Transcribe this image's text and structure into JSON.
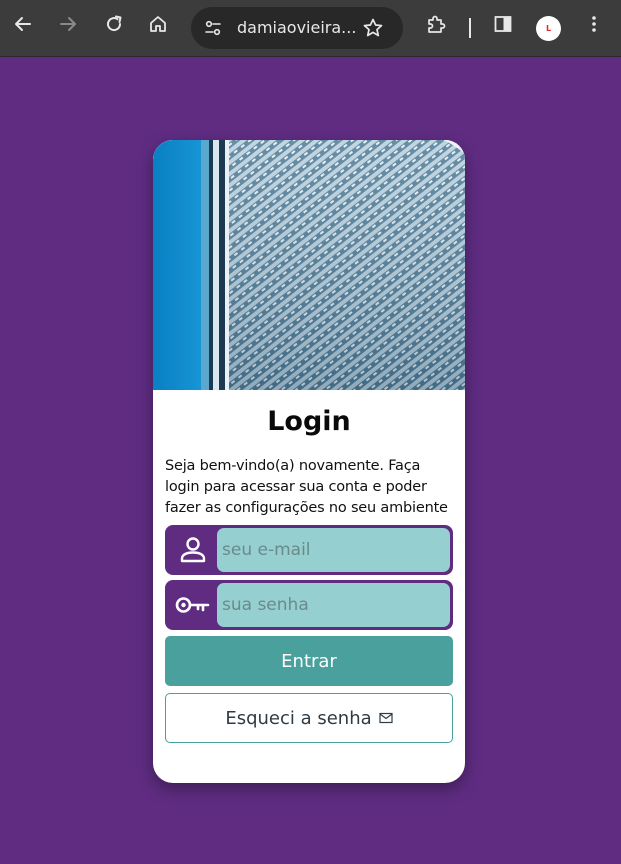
{
  "browser": {
    "url": "damiaovieira...",
    "profile_initial": "L"
  },
  "login": {
    "title": "Login",
    "description": "Seja bem-vindo(a) novamente. Faça login para acessar sua conta e poder fazer as configurações no seu ambiente",
    "email_placeholder": "seu e-mail",
    "password_placeholder": "sua senha",
    "submit_label": "Entrar",
    "forgot_label": "Esqueci a senha"
  },
  "colors": {
    "background": "#5f2c82",
    "input_fill": "#96cfcf",
    "primary_button": "#49a09d"
  }
}
